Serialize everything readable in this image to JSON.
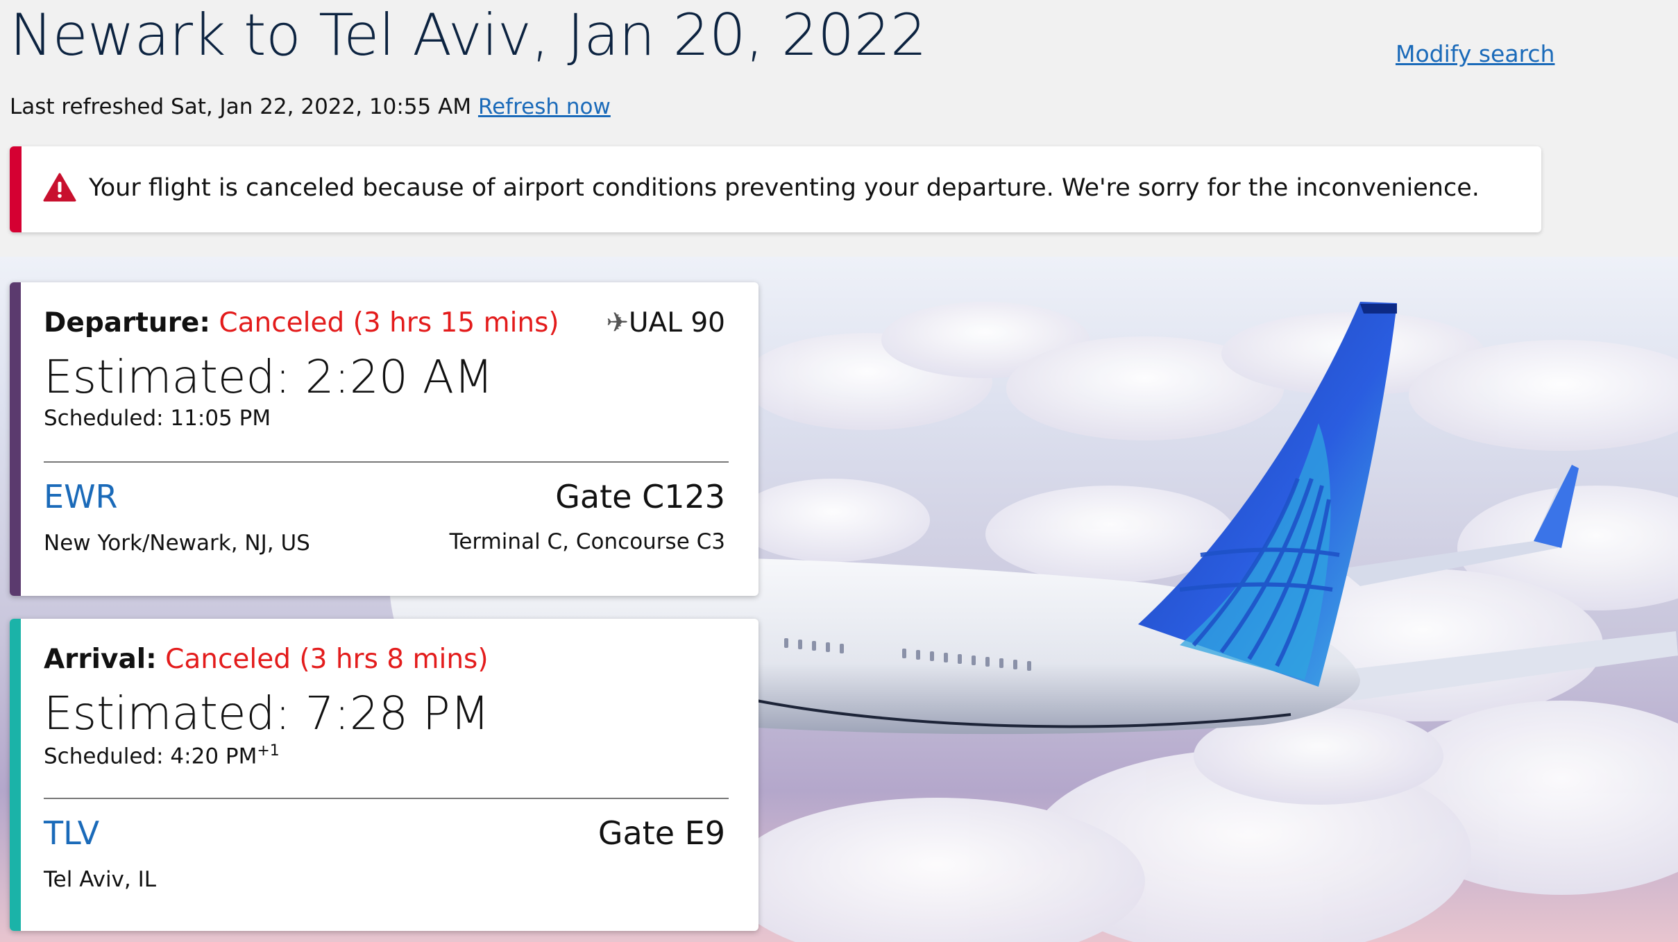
{
  "header": {
    "title": "Newark to Tel Aviv, Jan 20, 2022",
    "modify_search": "Modify search",
    "last_refreshed": "Last refreshed Sat, Jan 22, 2022, 10:55 AM",
    "refresh_now": "Refresh now"
  },
  "alert": {
    "icon": "warning-triangle-icon",
    "message": "Your flight is canceled because of airport conditions preventing your departure. We're sorry for the inconvenience.",
    "color": "#d50032"
  },
  "departure": {
    "label": "Departure:",
    "status": "Canceled (3 hrs 15 mins)",
    "flight_icon": "airplane-icon",
    "flight_number": "UAL 90",
    "estimated": "Estimated: 2:20 AM",
    "scheduled": "Scheduled: 11:05 PM",
    "airport_code": "EWR",
    "city": "New York/Newark, NJ, US",
    "gate": "Gate C123",
    "terminal": "Terminal C, Concourse C3",
    "accent_color": "#5b3a6e"
  },
  "arrival": {
    "label": "Arrival:",
    "status": "Canceled (3 hrs 8 mins)",
    "estimated": "Estimated: 7:28 PM",
    "scheduled": "Scheduled: 4:20 PM",
    "scheduled_day_offset": "+1",
    "airport_code": "TLV",
    "city": "Tel Aviv, IL",
    "gate": "Gate E9",
    "accent_color": "#1bb3a8"
  },
  "colors": {
    "link": "#1a6ab9",
    "status_red": "#e31b1b",
    "title": "#0c2340"
  }
}
